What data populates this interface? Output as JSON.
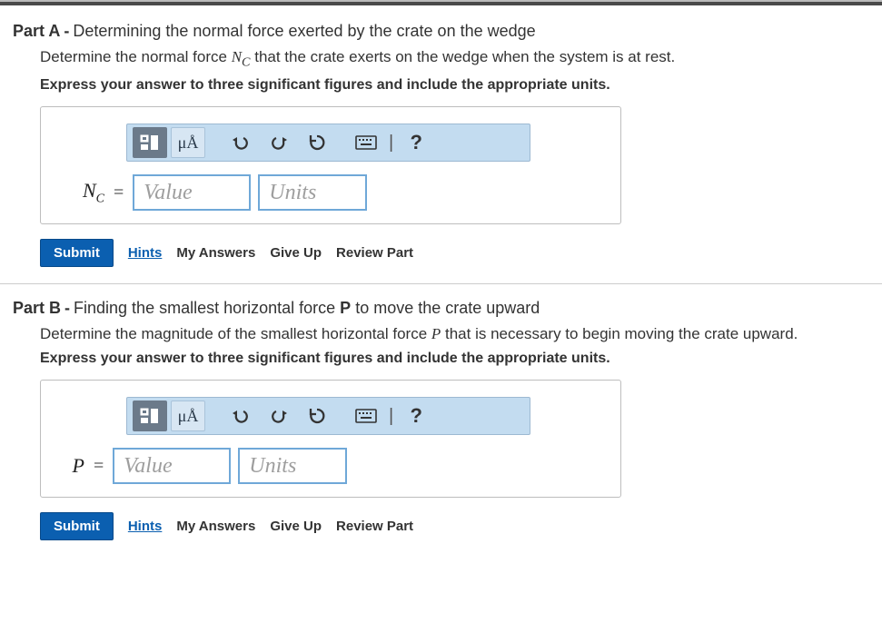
{
  "parts": {
    "a": {
      "label": "Part A",
      "title": "Determining the normal force exerted by the crate on the wedge",
      "desc_prefix": "Determine the normal force ",
      "desc_var": "N",
      "desc_sub": "C",
      "desc_suffix": " that the crate exerts on the wedge when the system is at rest.",
      "bold": "Express your answer to three significant figures and include the appropriate units.",
      "var": "N",
      "var_sub": "C",
      "value_ph": "Value",
      "units_ph": "Units"
    },
    "b": {
      "label": "Part B",
      "title": "Finding the smallest horizontal force P to move the crate upward",
      "desc_prefix": "Determine the magnitude of the smallest horizontal force ",
      "desc_var": "P",
      "desc_sub": "",
      "desc_suffix": " that is necessary to begin moving the crate upward.",
      "bold": "Express your answer to three significant figures and include the appropriate units.",
      "var": "P",
      "var_sub": "",
      "value_ph": "Value",
      "units_ph": "Units"
    }
  },
  "toolbar": {
    "template_label": "μÅ",
    "help_label": "?"
  },
  "actions": {
    "submit": "Submit",
    "hints": "Hints",
    "my_answers": "My Answers",
    "give_up": "Give Up",
    "review": "Review Part"
  },
  "eq": "="
}
